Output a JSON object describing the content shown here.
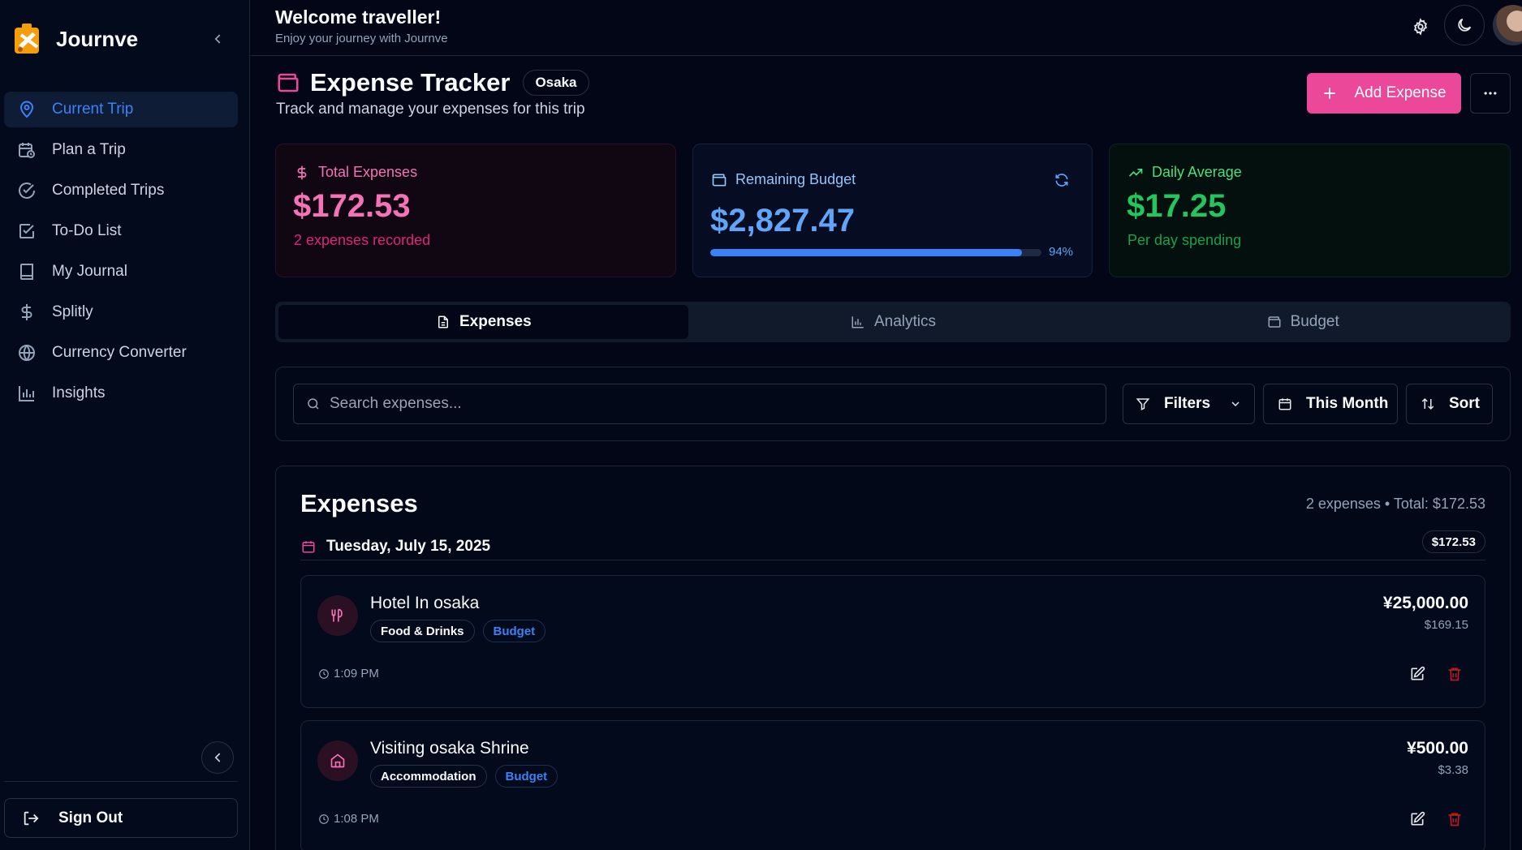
{
  "app": {
    "name": "Journve"
  },
  "colors": {
    "accent": "#ec4899",
    "primary": "#3b82f6",
    "success": "#22c55e",
    "danger": "#b91c1c",
    "background": "#020617"
  },
  "sidebar": {
    "items": [
      {
        "label": "Current Trip",
        "icon": "map-pin-icon",
        "active": true
      },
      {
        "label": "Plan a Trip",
        "icon": "calendar-clock-icon"
      },
      {
        "label": "Completed Trips",
        "icon": "check-circle-icon"
      },
      {
        "label": "To-Do List",
        "icon": "checkbox-icon"
      },
      {
        "label": "My Journal",
        "icon": "book-icon"
      },
      {
        "label": "Splitly",
        "icon": "dollar-icon"
      },
      {
        "label": "Currency Converter",
        "icon": "globe-icon"
      },
      {
        "label": "Insights",
        "icon": "bar-chart-icon"
      }
    ],
    "sign_out": "Sign Out"
  },
  "header": {
    "title": "Welcome traveller!",
    "subtitle": "Enjoy your journey with Journve"
  },
  "page": {
    "title": "Expense Tracker",
    "trip_badge": "Osaka",
    "subtitle": "Track and manage your expenses for this trip",
    "add_button": "Add Expense"
  },
  "stats": {
    "total": {
      "label": "Total Expenses",
      "value": "$172.53",
      "sub": "2 expenses recorded"
    },
    "remaining": {
      "label": "Remaining Budget",
      "value": "$2,827.47",
      "progress": 0.94,
      "percent_text": "94%"
    },
    "daily": {
      "label": "Daily Average",
      "value": "$17.25",
      "sub": "Per day spending"
    }
  },
  "tabs": [
    {
      "label": "Expenses",
      "icon": "file-text-icon",
      "active": true
    },
    {
      "label": "Analytics",
      "icon": "bar-chart-icon"
    },
    {
      "label": "Budget",
      "icon": "wallet-icon"
    }
  ],
  "filters": {
    "search_placeholder": "Search expenses...",
    "filters_label": "Filters",
    "period_label": "This Month",
    "sort_label": "Sort"
  },
  "expenses": {
    "title": "Expenses",
    "summary": "2 expenses • Total: $172.53",
    "groups": [
      {
        "date": "Tuesday, July 15, 2025",
        "total": "$172.53",
        "items": [
          {
            "name": "Hotel In osaka",
            "category": "Food & Drinks",
            "tag": "Budget",
            "amount": "¥25,000.00",
            "converted": "$169.15",
            "time": "1:09 PM",
            "icon": "utensils-icon"
          },
          {
            "name": "Visiting osaka Shrine",
            "category": "Accommodation",
            "tag": "Budget",
            "amount": "¥500.00",
            "converted": "$3.38",
            "time": "1:08 PM",
            "icon": "home-icon"
          }
        ]
      }
    ]
  }
}
